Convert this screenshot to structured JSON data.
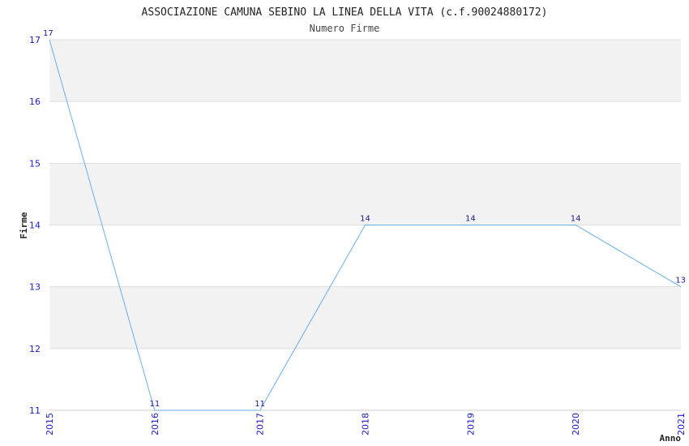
{
  "chart_data": {
    "type": "line",
    "title": "ASSOCIAZIONE CAMUNA SEBINO LA LINEA DELLA VITA (c.f.90024880172)",
    "subtitle": "Numero Firme",
    "xlabel": "Anno",
    "ylabel": "Firme",
    "x": [
      "2015",
      "2016",
      "2017",
      "2018",
      "2019",
      "2020",
      "2021"
    ],
    "values": [
      17,
      11,
      11,
      14,
      14,
      14,
      13
    ],
    "ylim": [
      11,
      17
    ],
    "yticks": [
      11,
      12,
      13,
      14,
      15,
      16,
      17
    ],
    "grid": true,
    "colors": {
      "line": "#6aaee8",
      "band": "#f2f2f2",
      "grid": "#dddddd",
      "tick_text": "#1a1acc",
      "label_text": "#1a1a99"
    }
  }
}
